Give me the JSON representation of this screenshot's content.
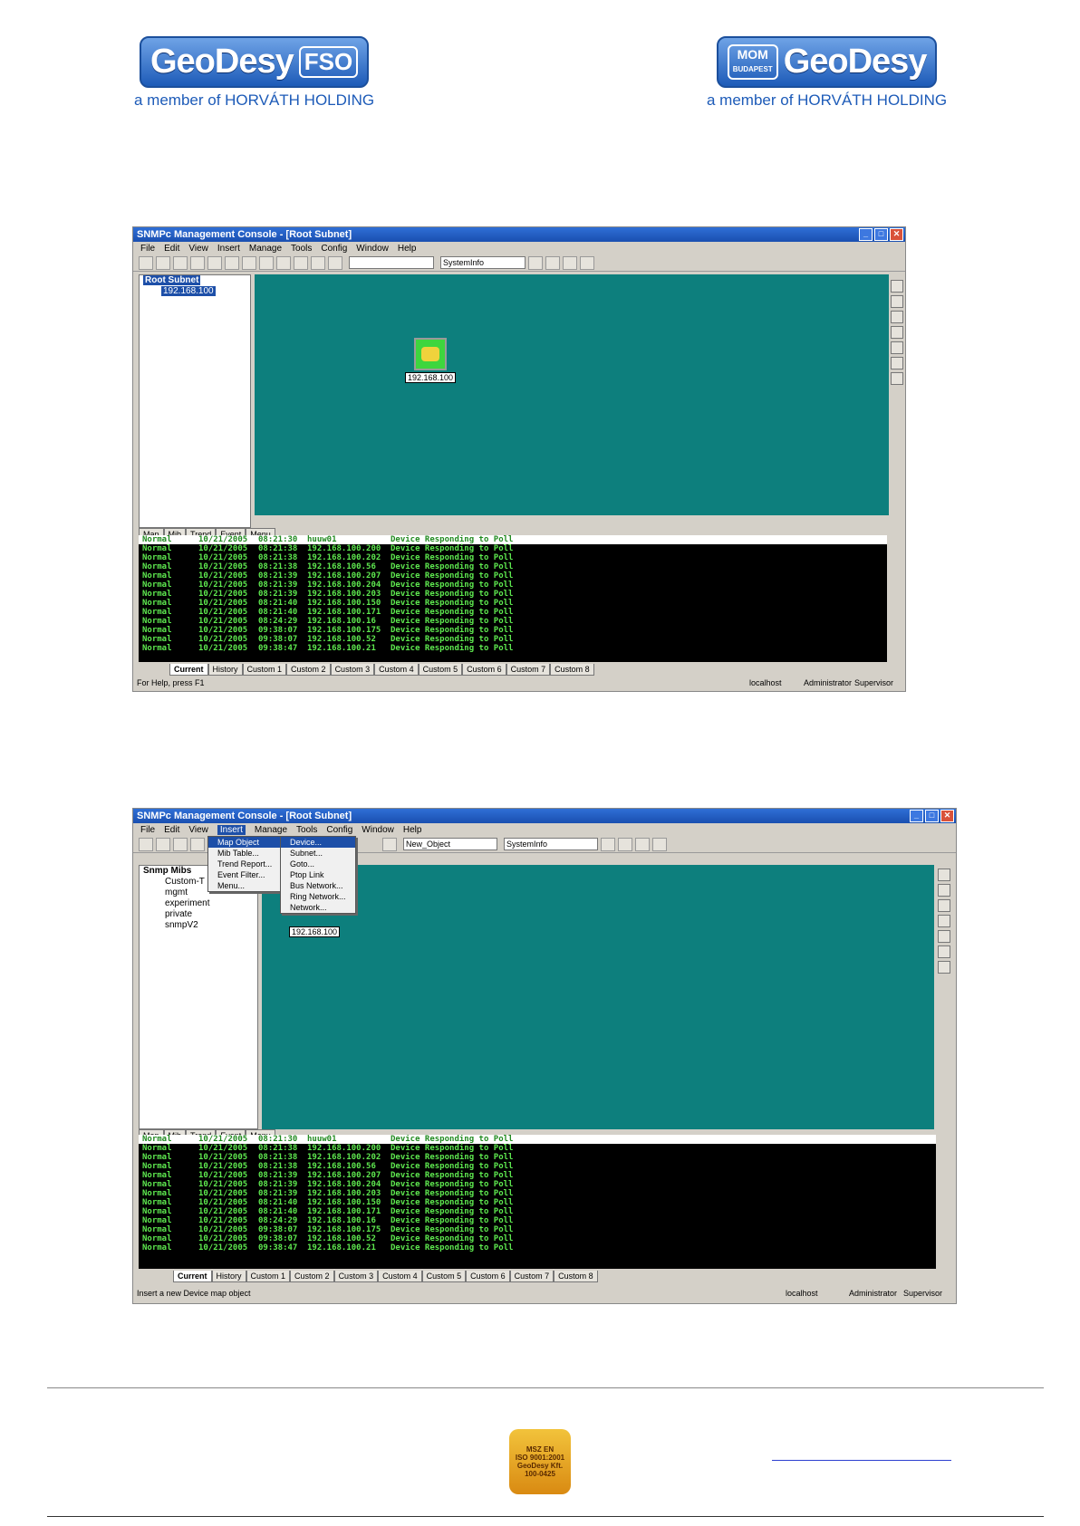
{
  "header": {
    "left_logo": {
      "name": "GeoDesy",
      "tag": "FSO",
      "subtitle": "a member of HORVÁTH HOLDING"
    },
    "right_logo": {
      "mom": "MOM",
      "mom_sub": "BUDAPEST",
      "name": "GeoDesy",
      "subtitle": "a member of HORVÁTH HOLDING"
    }
  },
  "shot1": {
    "title": "SNMPc Management Console - [Root Subnet]",
    "menu": [
      "File",
      "Edit",
      "View",
      "Insert",
      "Manage",
      "Tools",
      "Config",
      "Window",
      "Help"
    ],
    "combo1": "",
    "combo2": "SystemInfo",
    "tree_root": "Root Subnet",
    "tree_child": "192.168.100",
    "tree_tabs": [
      "Map",
      "Mib",
      "Trend",
      "Event",
      "Menu"
    ],
    "device_label": "192.168.100",
    "log_head": [
      "Normal",
      "10/21/2005",
      "08:21:30",
      "huuw01",
      "Device Responding to Poll"
    ],
    "log_rows": [
      [
        "Normal",
        "10/21/2005",
        "08:21:38",
        "192.168.100.200",
        "Device Responding to Poll"
      ],
      [
        "Normal",
        "10/21/2005",
        "08:21:38",
        "192.168.100.202",
        "Device Responding to Poll"
      ],
      [
        "Normal",
        "10/21/2005",
        "08:21:38",
        "192.168.100.56",
        "Device Responding to Poll"
      ],
      [
        "Normal",
        "10/21/2005",
        "08:21:39",
        "192.168.100.207",
        "Device Responding to Poll"
      ],
      [
        "Normal",
        "10/21/2005",
        "08:21:39",
        "192.168.100.204",
        "Device Responding to Poll"
      ],
      [
        "Normal",
        "10/21/2005",
        "08:21:39",
        "192.168.100.203",
        "Device Responding to Poll"
      ],
      [
        "Normal",
        "10/21/2005",
        "08:21:40",
        "192.168.100.150",
        "Device Responding to Poll"
      ],
      [
        "Normal",
        "10/21/2005",
        "08:21:40",
        "192.168.100.171",
        "Device Responding to Poll"
      ],
      [
        "Normal",
        "10/21/2005",
        "08:24:29",
        "192.168.100.16",
        "Device Responding to Poll"
      ],
      [
        "Normal",
        "10/21/2005",
        "09:38:07",
        "192.168.100.175",
        "Device Responding to Poll"
      ],
      [
        "Normal",
        "10/21/2005",
        "09:38:07",
        "192.168.100.52",
        "Device Responding to Poll"
      ],
      [
        "Normal",
        "10/21/2005",
        "09:38:47",
        "192.168.100.21",
        "Device Responding to Poll"
      ]
    ],
    "bottom_tabs": [
      "Current",
      "History",
      "Custom 1",
      "Custom 2",
      "Custom 3",
      "Custom 4",
      "Custom 5",
      "Custom 6",
      "Custom 7",
      "Custom 8"
    ],
    "status_left": "For Help, press F1",
    "status_right": [
      "localhost",
      "Administrator",
      "Supervisor"
    ]
  },
  "shot2": {
    "title": "SNMPc Management Console - [Root Subnet]",
    "menu": [
      "File",
      "Edit",
      "View",
      "Insert",
      "Manage",
      "Tools",
      "Config",
      "Window",
      "Help"
    ],
    "active_menu": "Insert",
    "combo1": "New_Object",
    "combo2": "SystemInfo",
    "tree_root": "Snmp Mibs",
    "tree_children": [
      "Custom-T",
      "mgmt",
      "experiment",
      "private",
      "snmpV2"
    ],
    "tree_tabs": [
      "Map",
      "Mib",
      "Trend",
      "Event",
      "Menu"
    ],
    "insert_menu": [
      "Map Object",
      "Mib Table...",
      "Trend Report...",
      "Event Filter...",
      "Menu..."
    ],
    "map_object_menu": [
      "Device...",
      "Subnet...",
      "Goto...",
      "Ptop Link",
      "Bus Network...",
      "Ring Network...",
      "Network..."
    ],
    "device_label": "192.168.100",
    "bottom_tabs": [
      "Current",
      "History",
      "Custom 1",
      "Custom 2",
      "Custom 3",
      "Custom 4",
      "Custom 5",
      "Custom 6",
      "Custom 7",
      "Custom 8"
    ],
    "status_left": "Insert a new Device map object",
    "status_right": [
      "localhost",
      "Administrator",
      "Supervisor"
    ]
  },
  "footer": {
    "iso_lines": [
      "MSZ EN",
      "ISO 9001:2001",
      "GeoDesy Kft.",
      "100-0425"
    ]
  }
}
